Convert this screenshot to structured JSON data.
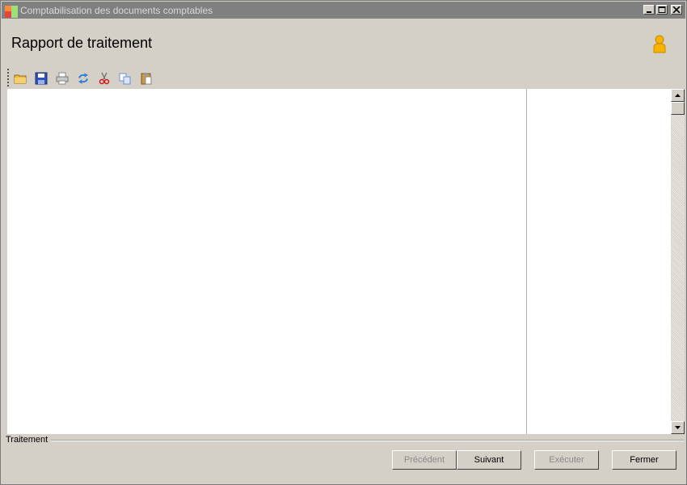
{
  "window": {
    "title": "Comptabilisation des documents comptables",
    "controls": [
      "minimize",
      "maximize",
      "close"
    ]
  },
  "header": {
    "title": "Rapport de traitement",
    "user_icon": "user-icon"
  },
  "toolbar": {
    "items": [
      "open-folder-icon",
      "save-icon",
      "print-icon",
      "refresh-icon",
      "cut-icon",
      "copy-icon",
      "paste-icon"
    ]
  },
  "footer": {
    "group_label": "Traitement",
    "buttons": {
      "previous": "Précédent",
      "next": "Suivant",
      "execute": "Exécuter",
      "close": "Fermer"
    }
  }
}
